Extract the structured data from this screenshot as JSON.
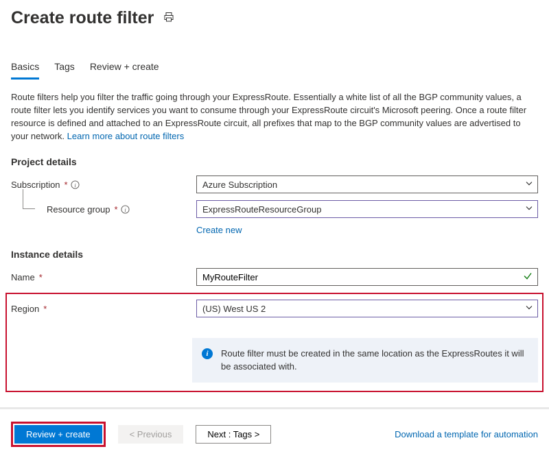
{
  "header": {
    "title": "Create route filter"
  },
  "tabs": {
    "basics": "Basics",
    "tags": "Tags",
    "review": "Review + create"
  },
  "description": {
    "text": "Route filters help you filter the traffic going through your ExpressRoute. Essentially a white list of all the BGP community values, a route filter lets you identify services you want to consume through your ExpressRoute circuit's Microsoft peering. Once a route filter resource is defined and attached to an ExpressRoute circuit, all prefixes that map to the BGP community values are advertised to your network.  ",
    "link": "Learn more about route filters"
  },
  "project": {
    "heading": "Project details",
    "subscription_label": "Subscription",
    "subscription_value": "Azure Subscription",
    "rg_label": "Resource group",
    "rg_value": "ExpressRouteResourceGroup",
    "create_new": "Create new"
  },
  "instance": {
    "heading": "Instance details",
    "name_label": "Name",
    "name_value": "MyRouteFilter",
    "region_label": "Region",
    "region_value": "(US) West US 2",
    "info_text": "Route filter must be created in the same location as the ExpressRoutes it will be associated with."
  },
  "footer": {
    "review": "Review + create",
    "previous": "< Previous",
    "next": "Next : Tags >",
    "download": "Download a template for automation"
  }
}
